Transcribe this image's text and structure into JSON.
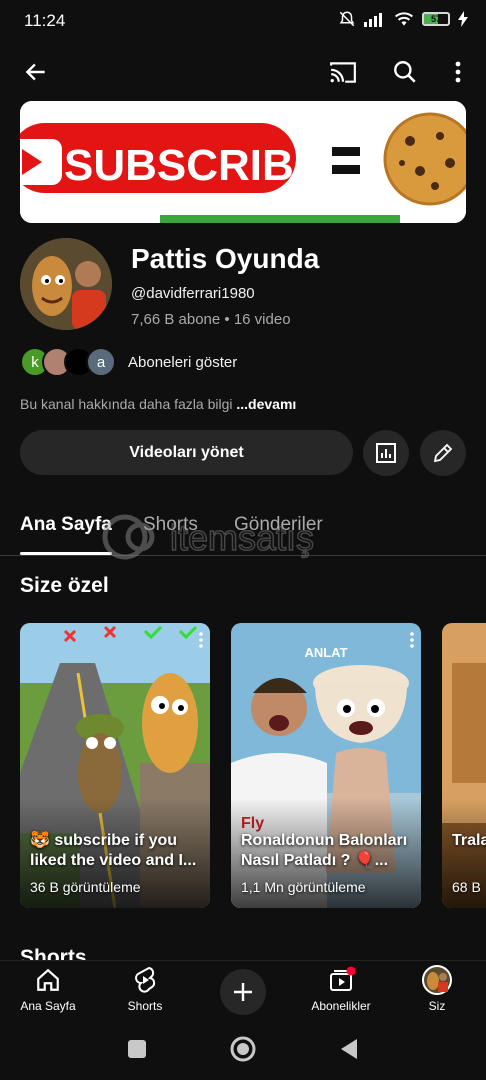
{
  "status": {
    "time": "11:24",
    "battery": "57",
    "battery_level": 0.57
  },
  "topbar": {
    "back_icon": "arrow-left-icon",
    "cast_icon": "cast-icon",
    "search_icon": "search-icon",
    "more_icon": "more-vert-icon"
  },
  "banner": {
    "text": "SUBSCRIBE"
  },
  "channel": {
    "name": "Pattis Oyunda",
    "handle": "@davidferrari1980",
    "stats": "7,66 B abone • 16 video",
    "subscribers_label": "Aboneleri göster",
    "sub_avatars": [
      "k",
      "",
      "",
      "a"
    ],
    "about_text": "Bu kanal hakkında daha fazla bilgi",
    "about_more": "...devamı"
  },
  "actions": {
    "manage_label": "Videoları yönet",
    "analytics_icon": "analytics-icon",
    "edit_icon": "pencil-icon"
  },
  "tabs": [
    {
      "label": "Ana Sayfa",
      "active": true
    },
    {
      "label": "Shorts",
      "active": false
    },
    {
      "label": "Gönderiler",
      "active": false
    }
  ],
  "watermark": {
    "text": "itemsatış"
  },
  "section": {
    "title": "Size özel"
  },
  "cards": [
    {
      "caption": "🐯 subscribe if you liked the video and I...",
      "views": "36 B görüntüleme",
      "overlay": ""
    },
    {
      "caption": "Ronaldonun Balonları Nasıl Patladı ? 🎈...",
      "views": "1,1 Mn görüntüleme",
      "overlay": "ANLAT"
    },
    {
      "caption": "Trala Drea...",
      "views": "68 B",
      "overlay": ""
    }
  ],
  "shorts_peek": "Shorts",
  "bottom_nav": [
    {
      "label": "Ana Sayfa",
      "icon": "home-icon"
    },
    {
      "label": "Shorts",
      "icon": "shorts-icon"
    },
    {
      "label": "",
      "icon": "plus-icon"
    },
    {
      "label": "Abonelikler",
      "icon": "subscriptions-icon"
    },
    {
      "label": "Siz",
      "icon": "avatar"
    }
  ]
}
